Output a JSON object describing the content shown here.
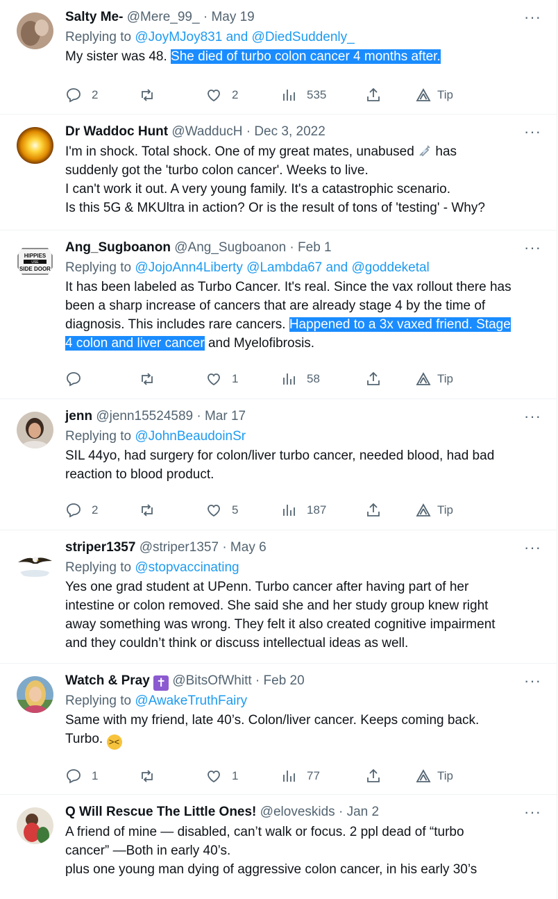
{
  "tweets": [
    {
      "name": "Salty Me-",
      "handle": "@Mere_99_",
      "date": "May 19",
      "reply_prefix": "Replying to ",
      "reply_to": "@JoyMJoy831 and @DiedSuddenly_",
      "text_plain": "My sister was 48. ",
      "text_highlight": "She died of turbo colon cancer 4 months after.",
      "replies": "2",
      "retweets": "",
      "likes": "2",
      "views": "535",
      "tip": "Tip"
    },
    {
      "name": "Dr Waddoc Hunt",
      "handle": "@WadducH",
      "date": "Dec 3, 2022",
      "line1a": "I'm in shock. Total shock. One of my great mates, unabused ",
      "line1b": " has",
      "line2": "suddenly got the 'turbo colon cancer'. Weeks to live.",
      "line3": "I can't work it out. A very young family. It's a catastrophic scenario.",
      "line4": "Is this 5G & MKUltra in action? Or is the result of tons of 'testing' - Why?"
    },
    {
      "name": "Ang_Sugboanon",
      "handle": "@Ang_Sugboanon",
      "date": "Feb 1",
      "reply_prefix": "Replying to ",
      "reply_to": "@JojoAnn4Liberty @Lambda67 and @goddeketal",
      "text_plain": "It has been labeled as Turbo Cancer. It's real. Since the vax rollout there has been a sharp increase of cancers that are already stage 4 by the time of diagnosis. This includes rare cancers. ",
      "text_highlight": "Happened to a 3x vaxed friend. Stage 4 colon and liver cancer",
      "text_after": " and Myelofibrosis.",
      "avatar_text": "HIPPIES USE SIDE DOOR",
      "replies": "",
      "retweets": "",
      "likes": "1",
      "views": "58",
      "tip": "Tip"
    },
    {
      "name": "jenn",
      "handle": "@jenn15524589",
      "date": "Mar 17",
      "reply_prefix": "Replying to ",
      "reply_to": "@JohnBeaudoinSr",
      "text_plain": "SIL 44yo, had surgery for colon/liver turbo cancer, needed blood, had bad reaction to blood product.",
      "replies": "2",
      "retweets": "",
      "likes": "5",
      "views": "187",
      "tip": "Tip"
    },
    {
      "name": "striper1357",
      "handle": "@striper1357",
      "date": "May 6",
      "reply_prefix": "Replying to ",
      "reply_to": "@stopvaccinating",
      "text_plain": "Yes one grad student at UPenn. Turbo cancer after having part of her intestine or colon removed. She said she and her study group knew right away something was wrong. They felt it also created cognitive impairment and they couldn’t think or discuss intellectual ideas as well."
    },
    {
      "name": "Watch & Pray",
      "handle": "@BitsOfWhitt",
      "date": "Feb 20",
      "reply_prefix": "Replying to ",
      "reply_to": "@AwakeTruthFairy",
      "text_plain": "Same with my friend, late 40’s. Colon/liver cancer.  Keeps coming back. Turbo. ",
      "replies": "1",
      "retweets": "",
      "likes": "1",
      "views": "77",
      "tip": "Tip"
    },
    {
      "name": "Q Will Rescue The Little Ones!",
      "handle": "@eloveskids",
      "date": "Jan 2",
      "line1": "A friend  of mine — disabled, can’t walk or focus. 2 ppl dead of  “turbo",
      "line2": "cancer” —Both in early 40’s.",
      "line3": "plus one young man dying of aggressive colon cancer, in his early 30’s"
    }
  ],
  "sep": "·",
  "more": "···",
  "colors": {
    "link": "#1d9bf0",
    "muted": "#536471",
    "highlight": "#1a8cff"
  }
}
